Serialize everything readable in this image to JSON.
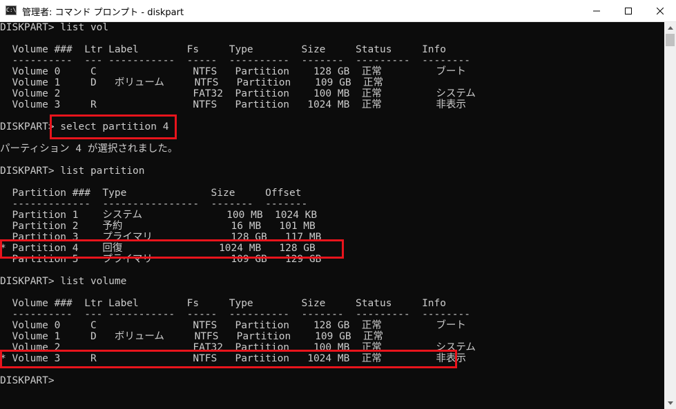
{
  "window": {
    "icon_text": "C:\\",
    "title": "管理者: コマンド プロンプト - diskpart",
    "controls": {
      "minimize": "minimize-icon",
      "maximize": "maximize-icon",
      "close": "close-icon"
    }
  },
  "console_lines": [
    "DISKPART> list vol",
    "",
    "  Volume ###  Ltr Label        Fs     Type        Size     Status     Info",
    "  ----------  --- -----------  -----  ----------  -------  ---------  --------",
    "  Volume 0     C                NTFS   Partition    128 GB  正常         ブート",
    "  Volume 1     D   ボリューム     NTFS   Partition    109 GB  正常",
    "  Volume 2                      FAT32  Partition    100 MB  正常         システム",
    "  Volume 3     R                NTFS   Partition   1024 MB  正常         非表示",
    "",
    "DISKPART> select partition 4",
    "",
    "パーティション 4 が選択されました。",
    "",
    "DISKPART> list partition",
    "",
    "  Partition ###  Type              Size     Offset",
    "  -------------  ----------------  -------  -------",
    "  Partition 1    システム              100 MB  1024 KB",
    "  Partition 2    予約                  16 MB   101 MB",
    "  Partition 3    プライマリ             128 GB   117 MB",
    "* Partition 4    回復                1024 MB   128 GB",
    "  Partition 5    プライマリ             109 GB   129 GB",
    "",
    "DISKPART> list volume",
    "",
    "  Volume ###  Ltr Label        Fs     Type        Size     Status     Info",
    "  ----------  --- -----------  -----  ----------  -------  ---------  --------",
    "  Volume 0     C                NTFS   Partition    128 GB  正常         ブート",
    "  Volume 1     D   ボリューム     NTFS   Partition    109 GB  正常",
    "  Volume 2                      FAT32  Partition    100 MB  正常         システム",
    "* Volume 3     R                NTFS   Partition   1024 MB  正常         非表示",
    "",
    "DISKPART>"
  ],
  "highlight_color": "#e8141c",
  "scrollbar": {
    "up": "scroll-up-arrow-icon",
    "down": "scroll-down-arrow-icon"
  }
}
